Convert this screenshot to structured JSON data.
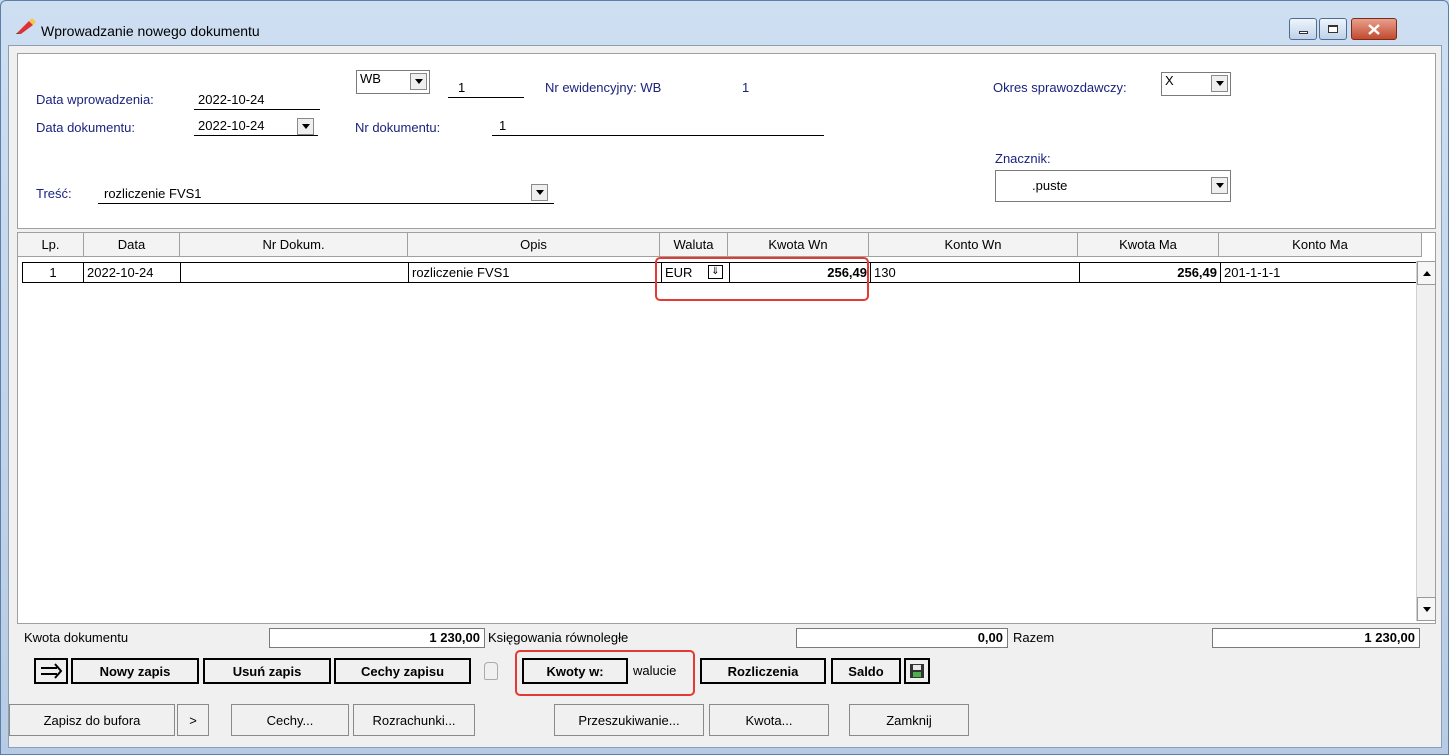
{
  "window": {
    "title": "Wprowadzanie nowego dokumentu"
  },
  "header": {
    "data_wprowadzenia_label": "Data wprowadzenia:",
    "data_wprowadzenia": "2022-10-24",
    "data_dokumentu_label": "Data dokumentu:",
    "data_dokumentu": "2022-10-24",
    "doc_type": "WB",
    "doc_number": "1",
    "nr_ewid_label": "Nr ewidencyjny: WB",
    "nr_ewid_value": "1",
    "nr_dokumentu_label": "Nr dokumentu:",
    "nr_dokumentu": "1",
    "okres_label": "Okres sprawozdawczy:",
    "okres_value": "X",
    "znacznik_label": "Znacznik:",
    "znacznik_value": ".puste",
    "tresc_label": "Treść:",
    "tresc_value": "rozliczenie FVS1"
  },
  "grid": {
    "columns": [
      "Lp.",
      "Data",
      "Nr Dokum.",
      "Opis",
      "Waluta",
      "Kwota Wn",
      "Konto Wn",
      "Kwota Ma",
      "Konto Ma"
    ],
    "rows": [
      {
        "lp": "1",
        "data": "2022-10-24",
        "nr_dokum": "",
        "opis": "rozliczenie FVS1",
        "waluta": "EUR",
        "kwota_wn": "256,49",
        "konto_wn": "130",
        "kwota_ma": "256,49",
        "konto_ma": "201-1-1-1"
      }
    ]
  },
  "summary": {
    "kwota_dokumentu_label": "Kwota dokumentu",
    "kwota_dokumentu": "1 230,00",
    "ksiegowania_label": "Księgowania równoległe",
    "ksiegowania": "0,00",
    "razem_label": "Razem",
    "razem": "1 230,00"
  },
  "toolbar": {
    "nowy_zapis": "Nowy zapis",
    "usun_zapis": "Usuń zapis",
    "cechy_zapisu": "Cechy zapisu",
    "kwoty_w": "Kwoty w:",
    "kwoty_w_value": "walucie",
    "rozliczenia": "Rozliczenia",
    "saldo": "Saldo"
  },
  "bottom": {
    "zapisz": "Zapisz do bufora",
    "more": ">",
    "cechy": "Cechy...",
    "rozrachunki": "Rozrachunki...",
    "przeszukiwanie": "Przeszukiwanie...",
    "kwota": "Kwota...",
    "zamknij": "Zamknij"
  },
  "colors": {
    "label_blue": "#1a237e",
    "highlight_red": "#e53935"
  }
}
